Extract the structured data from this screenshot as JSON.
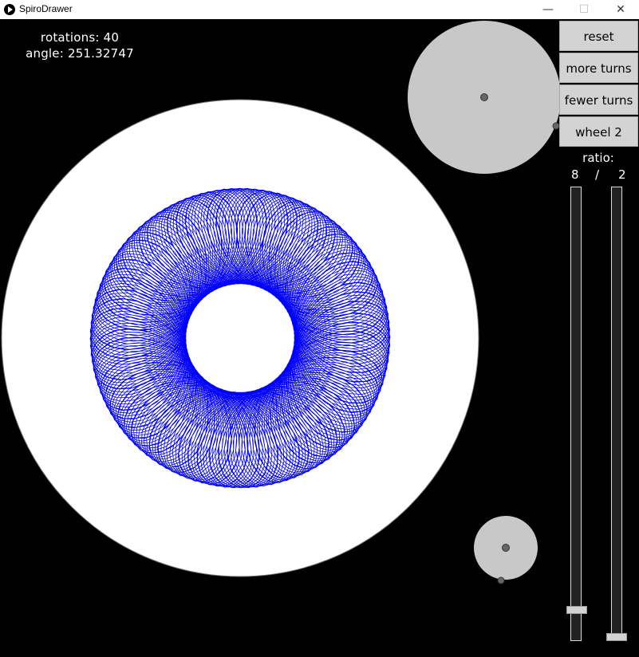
{
  "window": {
    "title": "SpiroDrawer",
    "controls": {
      "minimize": "—",
      "maximize": "☐",
      "close": "✕"
    }
  },
  "hud": {
    "rotations": "rotations: 40",
    "angle": "angle: 251.32747"
  },
  "buttons": {
    "reset": "reset",
    "more_turns": "more turns",
    "fewer_turns": "fewer turns",
    "wheel": "wheel 2"
  },
  "ratio": {
    "label": "ratio:",
    "numerator": "8",
    "slash": "/",
    "denominator": "2"
  },
  "sliders": {
    "numerator_fraction": 0.94,
    "denominator_fraction": 1.0
  },
  "colors": {
    "pen": "#0000ff",
    "canvas": "#000000",
    "disc": "#ffffff",
    "wheel": "#c8c8c8",
    "button": "#d3d3d3"
  }
}
